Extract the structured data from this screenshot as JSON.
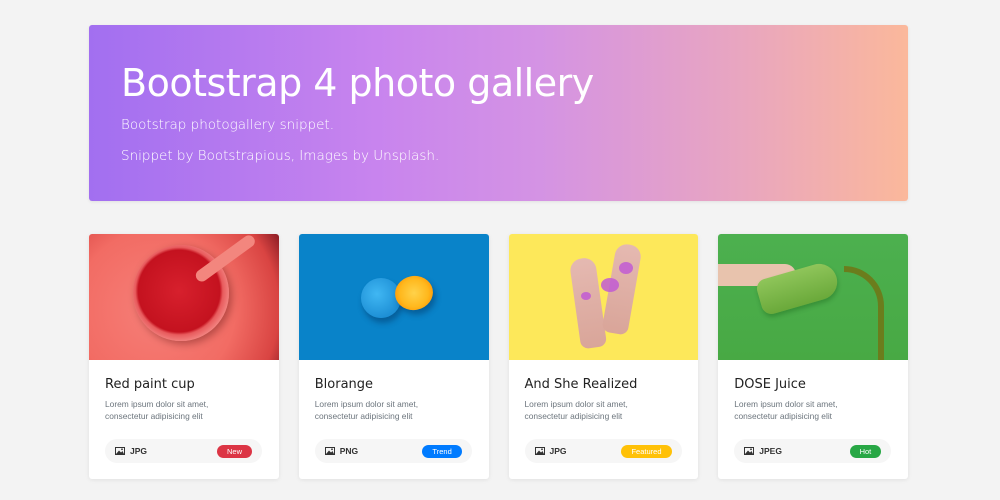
{
  "hero": {
    "title": "Bootstrap 4 photo gallery",
    "subtitle": "Bootstrap photogallery snippet.",
    "credits": "Snippet by Bootstrapious, Images by Unsplash."
  },
  "cards": [
    {
      "title": "Red paint cup",
      "text": "Lorem ipsum dolor sit amet, consectetur adipisicing elit",
      "format": "JPG",
      "badge": "New",
      "badge_color": "#dc3545"
    },
    {
      "title": "Blorange",
      "text": "Lorem ipsum dolor sit amet, consectetur adipisicing elit",
      "format": "PNG",
      "badge": "Trend",
      "badge_color": "#007bff"
    },
    {
      "title": "And She Realized",
      "text": "Lorem ipsum dolor sit amet, consectetur adipisicing elit",
      "format": "JPG",
      "badge": "Featured",
      "badge_color": "#ffc107"
    },
    {
      "title": "DOSE Juice",
      "text": "Lorem ipsum dolor sit amet, consectetur adipisicing elit",
      "format": "JPEG",
      "badge": "Hot",
      "badge_color": "#28a745"
    }
  ],
  "icons": {
    "format_icon": "image-icon"
  }
}
